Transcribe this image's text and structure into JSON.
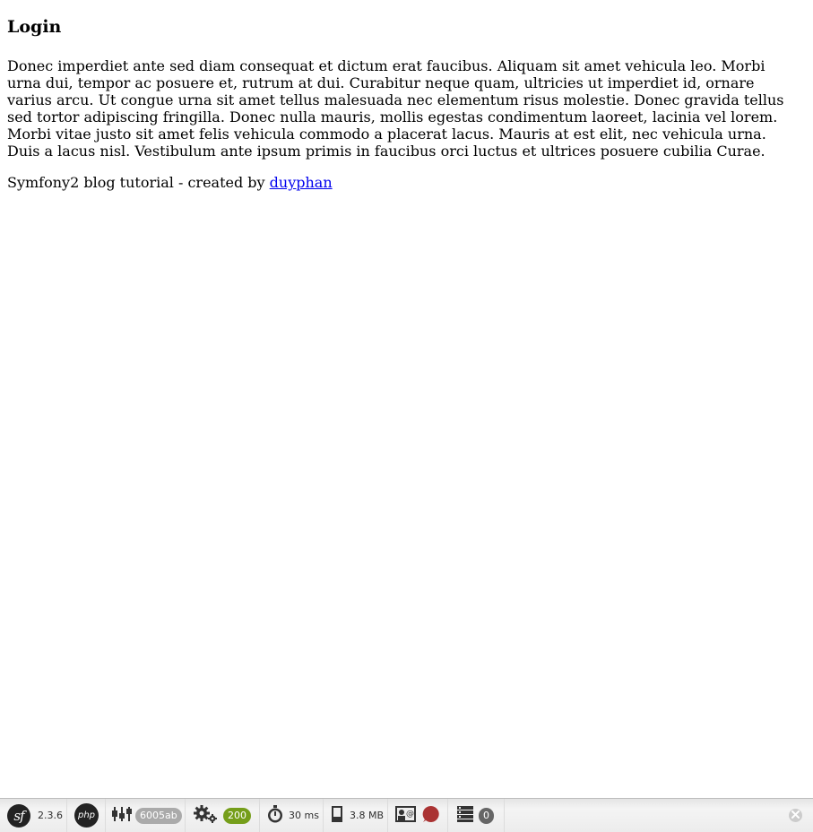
{
  "page": {
    "title": "Login",
    "body": "Donec imperdiet ante sed diam consequat et dictum erat faucibus. Aliquam sit amet vehicula leo. Morbi urna dui, tempor ac posuere et, rutrum at dui. Curabitur neque quam, ultricies ut imperdiet id, ornare varius arcu. Ut congue urna sit amet tellus malesuada nec elementum risus molestie. Donec gravida tellus sed tortor adipiscing fringilla. Donec nulla mauris, mollis egestas condimentum laoreet, lacinia vel lorem. Morbi vitae justo sit amet felis vehicula commodo a placerat lacus. Mauris at est elit, nec vehicula urna. Duis a lacus nisl. Vestibulum ante ipsum primis in faucibus orci luctus et ultrices posuere cubilia Curae.",
    "footer_text": "Symfony2 blog tutorial - created by ",
    "footer_link": "duyphan"
  },
  "toolbar": {
    "symfony_logo": "sf",
    "symfony_version": "2.3.6",
    "php_logo": "php",
    "token": "6005ab",
    "status_code": "200",
    "time": "30 ms",
    "memory": "3.8 MB",
    "db_queries": "0",
    "icons": {
      "symfony": "symfony-logo-icon",
      "php": "php-logo-icon",
      "request": "request-config-icon",
      "gear": "gear-icon",
      "timer": "stopwatch-icon",
      "memory": "memory-icon",
      "security": "user-security-icon",
      "status": "status-red-icon",
      "database": "database-icon",
      "close": "close-icon"
    },
    "colors": {
      "status_ok": "#759e1a",
      "badge_grey": "#aaaaaa",
      "badge_dark": "#666666",
      "error_red": "#aa3333"
    }
  }
}
